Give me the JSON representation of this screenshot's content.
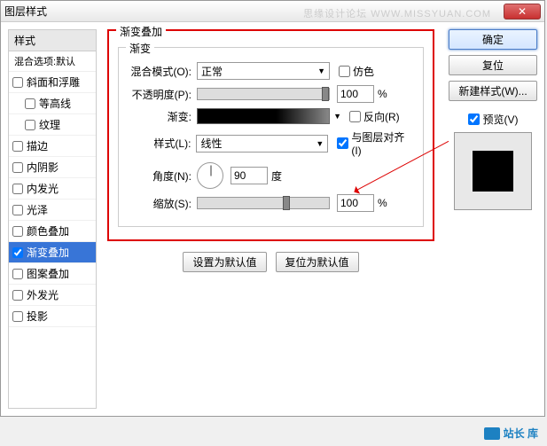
{
  "window": {
    "title": "图层样式"
  },
  "watermark": "思缘设计论坛  WWW.MISSYUAN.COM",
  "sidebar": {
    "header": "样式",
    "sub": "混合选项:默认",
    "items": [
      {
        "label": "斜面和浮雕",
        "checked": false,
        "indent": false
      },
      {
        "label": "等高线",
        "checked": false,
        "indent": true
      },
      {
        "label": "纹理",
        "checked": false,
        "indent": true
      },
      {
        "label": "描边",
        "checked": false,
        "indent": false
      },
      {
        "label": "内阴影",
        "checked": false,
        "indent": false
      },
      {
        "label": "内发光",
        "checked": false,
        "indent": false
      },
      {
        "label": "光泽",
        "checked": false,
        "indent": false
      },
      {
        "label": "颜色叠加",
        "checked": false,
        "indent": false
      },
      {
        "label": "渐变叠加",
        "checked": true,
        "indent": false,
        "selected": true
      },
      {
        "label": "图案叠加",
        "checked": false,
        "indent": false
      },
      {
        "label": "外发光",
        "checked": false,
        "indent": false
      },
      {
        "label": "投影",
        "checked": false,
        "indent": false
      }
    ]
  },
  "panel": {
    "title": "渐变叠加",
    "group": "渐变",
    "blend_label": "混合模式(O):",
    "blend_value": "正常",
    "dither_label": "仿色",
    "opacity_label": "不透明度(P):",
    "opacity_value": "100",
    "pct": "%",
    "gradient_label": "渐变:",
    "reverse_label": "反向(R)",
    "style_label": "样式(L):",
    "style_value": "线性",
    "align_label": "与图层对齐(I)",
    "angle_label": "角度(N):",
    "angle_value": "90",
    "deg": "度",
    "scale_label": "缩放(S):",
    "scale_value": "100",
    "btn_default": "设置为默认值",
    "btn_reset": "复位为默认值"
  },
  "right": {
    "ok": "确定",
    "reset": "复位",
    "newstyle": "新建样式(W)...",
    "preview_label": "预览(V)"
  },
  "footer": "站长  库"
}
